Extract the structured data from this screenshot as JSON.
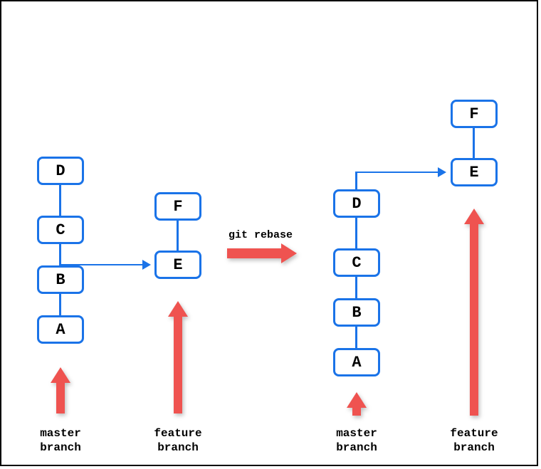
{
  "before": {
    "master": {
      "commits": [
        "A",
        "B",
        "C",
        "D"
      ],
      "label": "master\nbranch"
    },
    "feature": {
      "commits": [
        "E",
        "F"
      ],
      "label": "feature\nbranch",
      "base": "B"
    }
  },
  "after": {
    "master": {
      "commits": [
        "A",
        "B",
        "C",
        "D"
      ],
      "label": "master\nbranch"
    },
    "feature": {
      "commits": [
        "E",
        "F"
      ],
      "label": "feature\nbranch",
      "base": "D"
    }
  },
  "command": "git rebase"
}
